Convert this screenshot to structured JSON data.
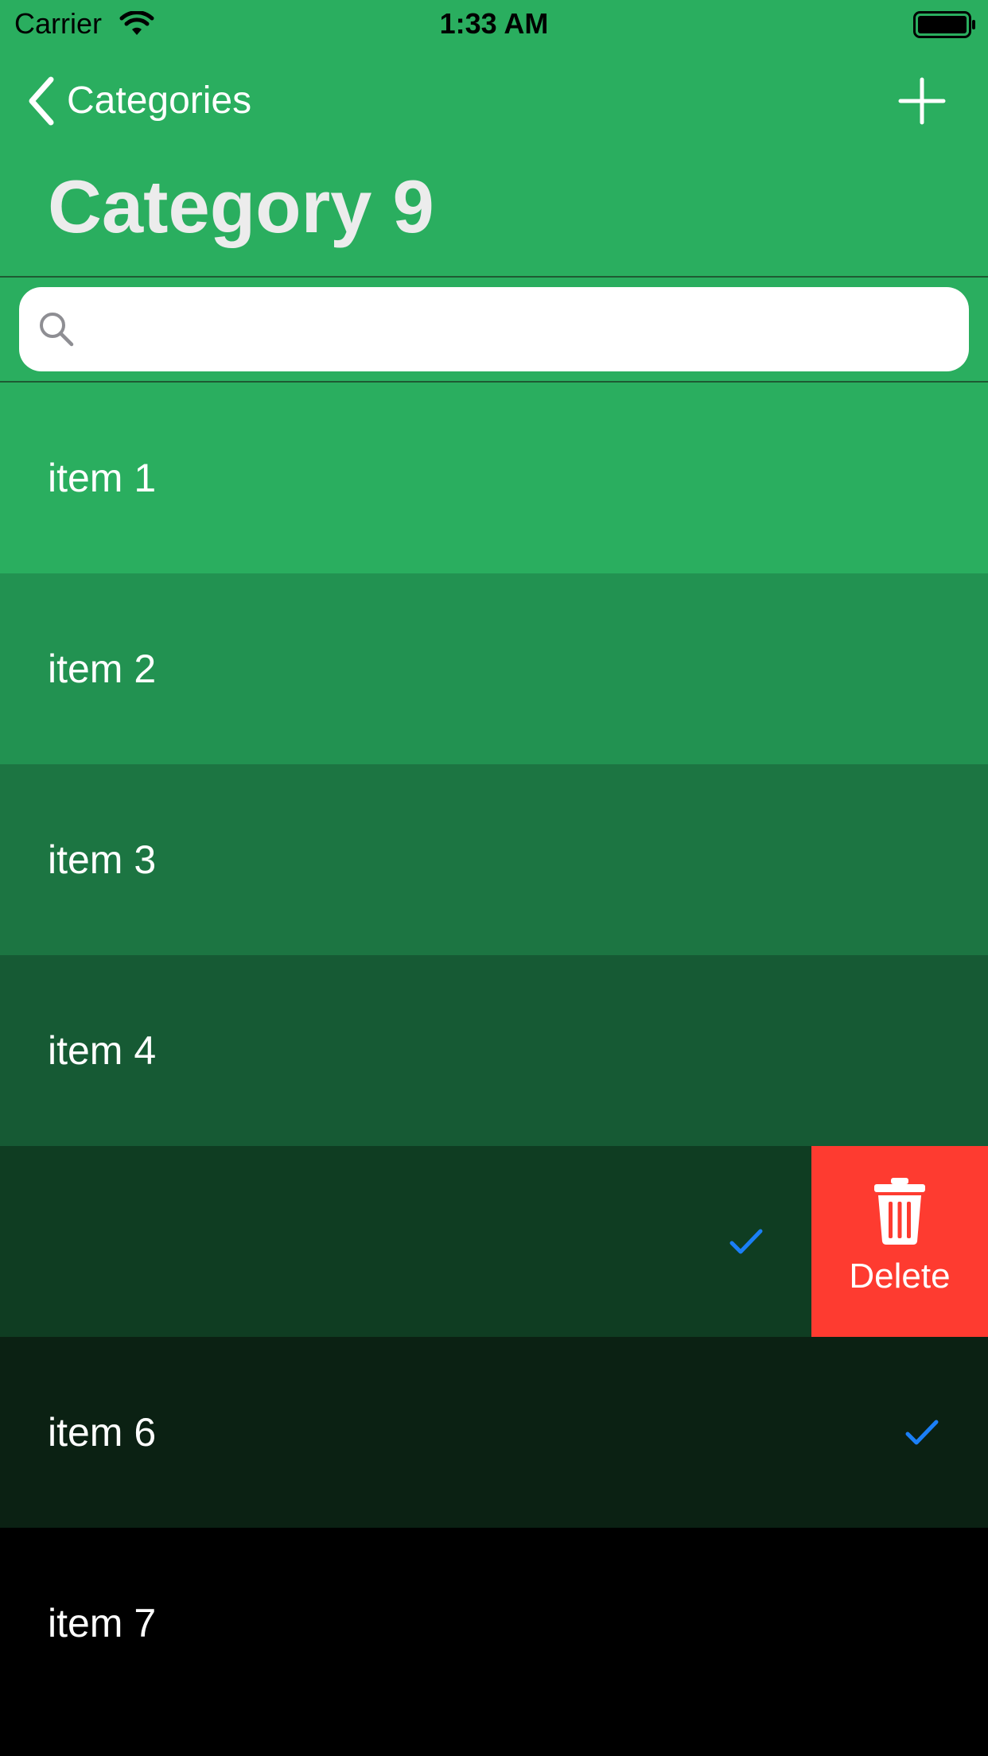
{
  "status_bar": {
    "carrier": "Carrier",
    "time": "1:33 AM"
  },
  "nav": {
    "back_label": "Categories",
    "add_icon": "plus-icon"
  },
  "page": {
    "title": "Category 9"
  },
  "search": {
    "value": "",
    "placeholder": ""
  },
  "rows": [
    {
      "label": "item 1",
      "checked": false,
      "color": "#2aae5f"
    },
    {
      "label": "item 2",
      "checked": false,
      "color": "#229251"
    },
    {
      "label": "item 3",
      "checked": false,
      "color": "#1c7542"
    },
    {
      "label": "item 4",
      "checked": false,
      "color": "#165a34"
    },
    {
      "label": "",
      "checked": true,
      "color": "#0f3d22",
      "swiped": true
    },
    {
      "label": "item 6",
      "checked": true,
      "color": "#0b2113"
    },
    {
      "label": "item 7",
      "checked": false,
      "color": "#000000"
    }
  ],
  "swipe_action": {
    "label": "Delete",
    "icon": "trash-icon",
    "color": "#fe3b30"
  },
  "colors": {
    "accent": "#2aae5f",
    "check": "#1b7ff6",
    "title": "#ececec"
  }
}
